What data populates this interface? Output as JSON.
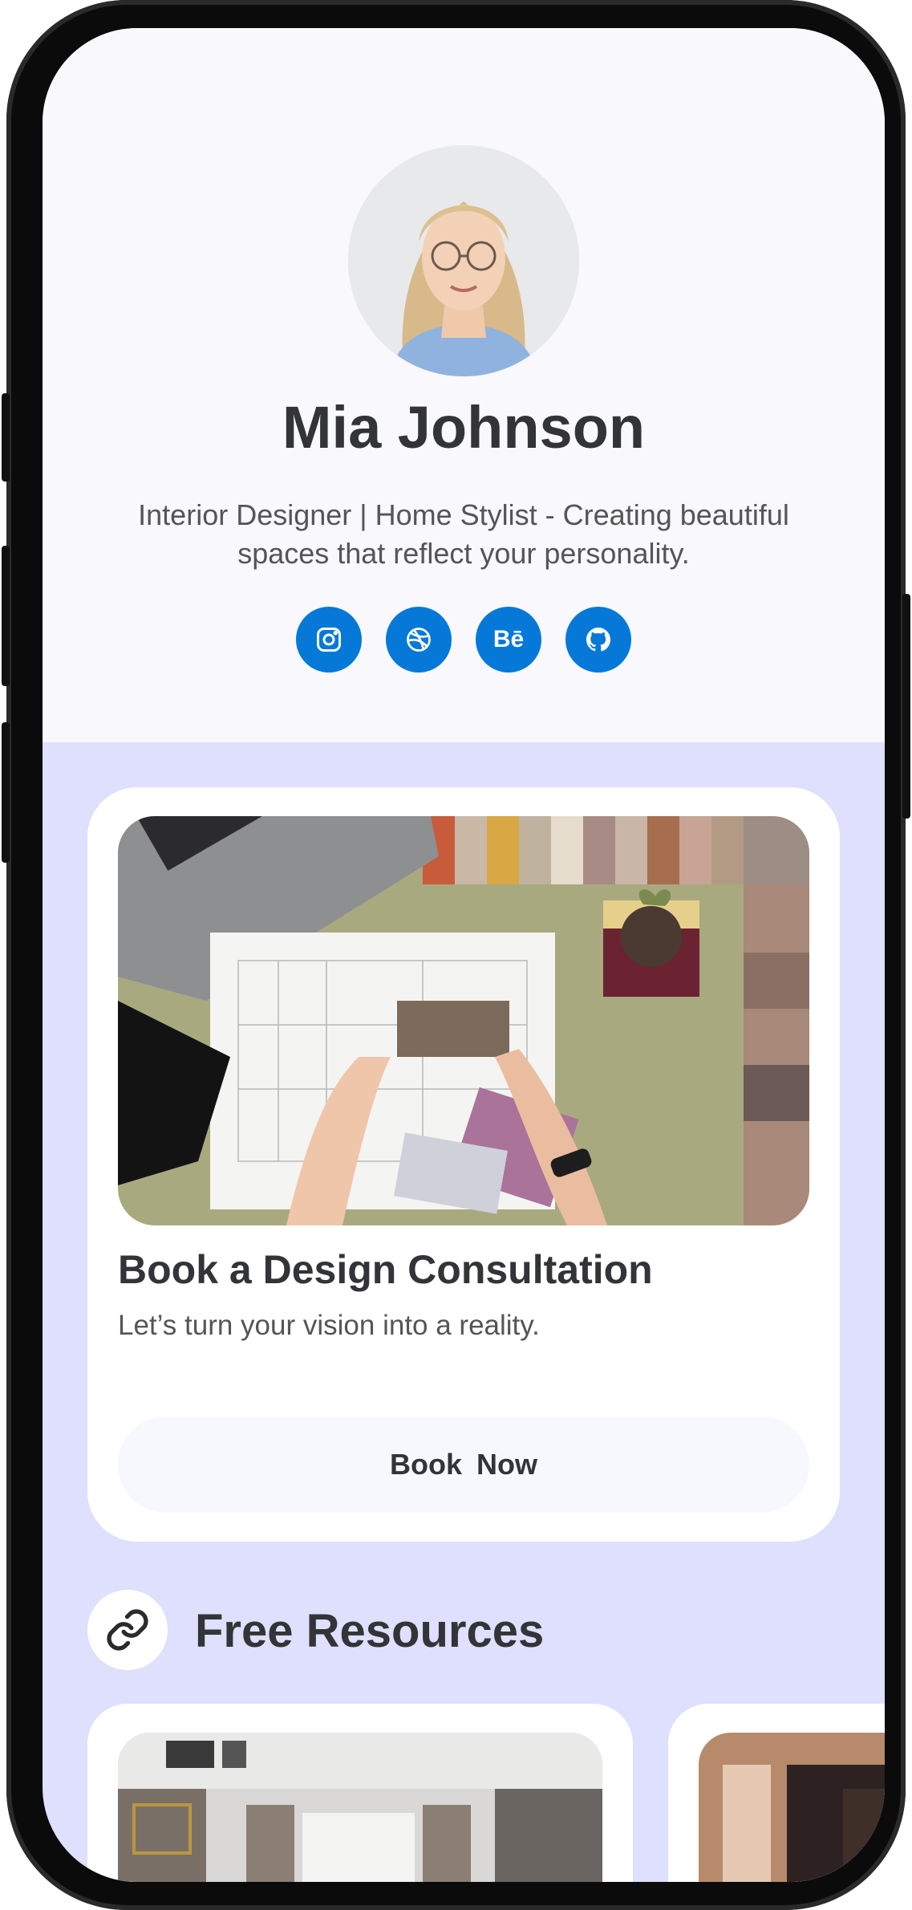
{
  "profile": {
    "name": "Mia Johnson",
    "bio": "Interior Designer | Home Stylist - Creating beautiful spaces that reflect your personality."
  },
  "socials": [
    {
      "icon": "instagram-icon"
    },
    {
      "icon": "dribbble-icon"
    },
    {
      "icon": "behance-icon",
      "label": "Bē"
    },
    {
      "icon": "github-icon"
    }
  ],
  "consultation": {
    "title": "Book a Design Consultation",
    "subtitle": "Let’s turn your vision into a reality.",
    "button_label": "Book  Now"
  },
  "resources": {
    "title": "Free Resources",
    "icon": "link-icon"
  },
  "colors": {
    "accent": "#0679d8",
    "profile_bg": "#f8f8fd",
    "page_bg": "#dfe0fd",
    "text": "#333438"
  }
}
